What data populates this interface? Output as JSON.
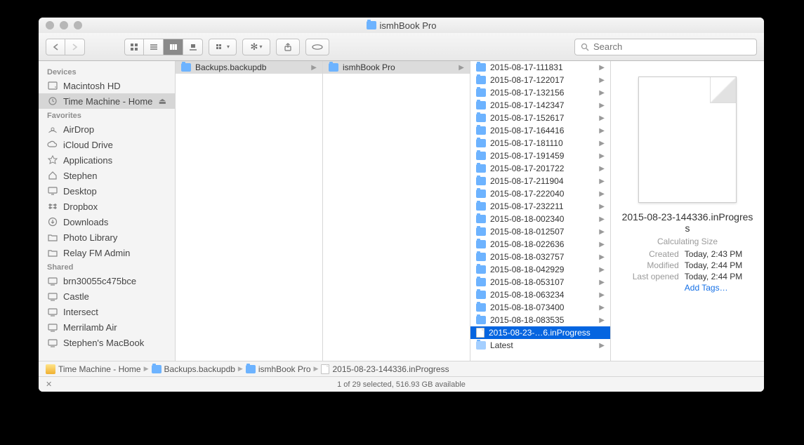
{
  "window_title": "ismhBook Pro",
  "search_placeholder": "Search",
  "sidebar": {
    "sections": [
      {
        "header": "Devices",
        "items": [
          {
            "label": "Macintosh HD",
            "icon": "hdd",
            "selected": false,
            "eject": false
          },
          {
            "label": "Time Machine - Home",
            "icon": "tm",
            "selected": true,
            "eject": true
          }
        ]
      },
      {
        "header": "Favorites",
        "items": [
          {
            "label": "AirDrop",
            "icon": "airdrop"
          },
          {
            "label": "iCloud Drive",
            "icon": "cloud"
          },
          {
            "label": "Applications",
            "icon": "apps"
          },
          {
            "label": "Stephen",
            "icon": "home"
          },
          {
            "label": "Desktop",
            "icon": "desktop"
          },
          {
            "label": "Dropbox",
            "icon": "dropbox"
          },
          {
            "label": "Downloads",
            "icon": "downloads"
          },
          {
            "label": "Photo Library",
            "icon": "folder"
          },
          {
            "label": "Relay FM Admin",
            "icon": "folder"
          }
        ]
      },
      {
        "header": "Shared",
        "items": [
          {
            "label": "brn30055c475bce",
            "icon": "net"
          },
          {
            "label": "Castle",
            "icon": "net"
          },
          {
            "label": "Intersect",
            "icon": "net"
          },
          {
            "label": "Merrilamb Air",
            "icon": "net"
          },
          {
            "label": "Stephen's MacBook",
            "icon": "net"
          }
        ]
      }
    ]
  },
  "columns": [
    {
      "items": [
        {
          "label": "Backups.backupdb",
          "type": "folder",
          "selected": true
        }
      ]
    },
    {
      "items": [
        {
          "label": "ismhBook Pro",
          "type": "folder",
          "selected": true
        }
      ]
    },
    {
      "items": [
        {
          "label": "2015-08-17-111831",
          "type": "folder"
        },
        {
          "label": "2015-08-17-122017",
          "type": "folder"
        },
        {
          "label": "2015-08-17-132156",
          "type": "folder"
        },
        {
          "label": "2015-08-17-142347",
          "type": "folder"
        },
        {
          "label": "2015-08-17-152617",
          "type": "folder"
        },
        {
          "label": "2015-08-17-164416",
          "type": "folder"
        },
        {
          "label": "2015-08-17-181110",
          "type": "folder"
        },
        {
          "label": "2015-08-17-191459",
          "type": "folder"
        },
        {
          "label": "2015-08-17-201722",
          "type": "folder"
        },
        {
          "label": "2015-08-17-211904",
          "type": "folder"
        },
        {
          "label": "2015-08-17-222040",
          "type": "folder"
        },
        {
          "label": "2015-08-17-232211",
          "type": "folder"
        },
        {
          "label": "2015-08-18-002340",
          "type": "folder"
        },
        {
          "label": "2015-08-18-012507",
          "type": "folder"
        },
        {
          "label": "2015-08-18-022636",
          "type": "folder"
        },
        {
          "label": "2015-08-18-032757",
          "type": "folder"
        },
        {
          "label": "2015-08-18-042929",
          "type": "folder"
        },
        {
          "label": "2015-08-18-053107",
          "type": "folder"
        },
        {
          "label": "2015-08-18-063234",
          "type": "folder"
        },
        {
          "label": "2015-08-18-073400",
          "type": "folder"
        },
        {
          "label": "2015-08-18-083535",
          "type": "folder"
        },
        {
          "label": "2015-08-23-…6.inProgress",
          "type": "doc",
          "selected": true
        },
        {
          "label": "Latest",
          "type": "alias"
        }
      ]
    }
  ],
  "preview": {
    "name": "2015-08-23-144336.inProgress",
    "size": "Calculating Size",
    "created_k": "Created",
    "created_v": "Today, 2:43 PM",
    "modified_k": "Modified",
    "modified_v": "Today, 2:44 PM",
    "opened_k": "Last opened",
    "opened_v": "Today, 2:44 PM",
    "add_tags": "Add Tags…"
  },
  "pathbar": [
    {
      "label": "Time Machine - Home",
      "icon": "disk"
    },
    {
      "label": "Backups.backupdb",
      "icon": "folder"
    },
    {
      "label": "ismhBook Pro",
      "icon": "folder"
    },
    {
      "label": "2015-08-23-144336.inProgress",
      "icon": "doc"
    }
  ],
  "status": "1 of 29 selected, 516.93 GB available"
}
